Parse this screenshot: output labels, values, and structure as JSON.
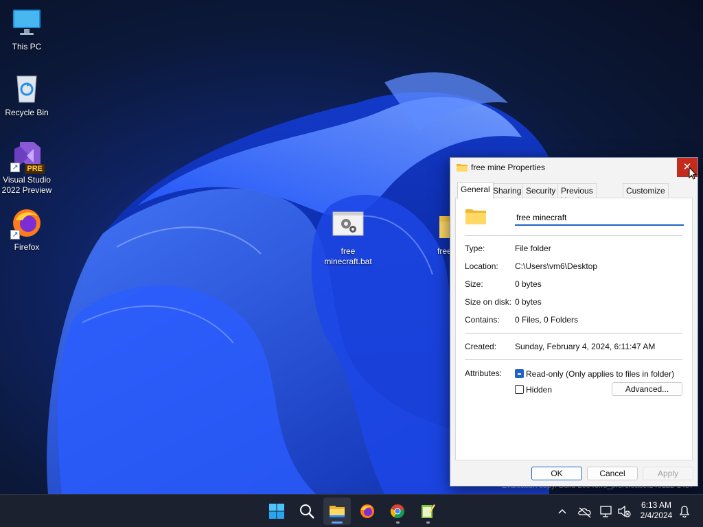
{
  "desktop": {
    "icons": [
      {
        "label": "This PC",
        "icon": "monitor-icon"
      },
      {
        "label": "Recycle Bin",
        "icon": "recycle-bin-icon"
      },
      {
        "label": "Visual Studio 2022 Preview",
        "icon": "visual-studio-icon",
        "badge": "PRE"
      },
      {
        "label": "Firefox",
        "icon": "firefox-icon"
      },
      {
        "label": "free minecraft.bat",
        "icon": "batch-file-icon"
      },
      {
        "label": "free",
        "icon": "folder-icon"
      }
    ]
  },
  "window": {
    "title": "free mine Properties",
    "close_glyph": "✕",
    "tabs": [
      "General",
      "Sharing",
      "Security",
      "Previous Versions",
      "Customize"
    ],
    "active_tab": "General",
    "name_value": "free minecraft",
    "fields": [
      {
        "label": "Type:",
        "value": "File folder"
      },
      {
        "label": "Location:",
        "value": "C:\\Users\\vm6\\Desktop"
      },
      {
        "label": "Size:",
        "value": "0 bytes"
      },
      {
        "label": "Size on disk:",
        "value": "0 bytes"
      },
      {
        "label": "Contains:",
        "value": "0 Files, 0 Folders"
      }
    ],
    "created": {
      "label": "Created:",
      "value": "Sunday, February 4, 2024, 6:11:47 AM"
    },
    "attributes": {
      "label": "Attributes:",
      "readonly_label": "Read-only (Only applies to files in folder)",
      "readonly_state": "indeterminate",
      "hidden_label": "Hidden",
      "hidden_checked": false,
      "advanced_label": "Advanced..."
    },
    "buttons": {
      "ok": "OK",
      "cancel": "Cancel",
      "apply": "Apply"
    }
  },
  "watermark": "Evaluation copy. Build 26040.rs_prerelease.240122-1457",
  "taskbar": {
    "apps": [
      "start-icon",
      "search-icon",
      "file-explorer-icon",
      "firefox-icon",
      "chrome-icon",
      "notepad-icon"
    ],
    "active_app": "file-explorer-icon",
    "clock": {
      "time": "6:13 AM",
      "date": "2/4/2024"
    }
  },
  "colors": {
    "accent": "#1f63c4",
    "close_red": "#c42b1c",
    "taskbar": "#1c2130"
  }
}
